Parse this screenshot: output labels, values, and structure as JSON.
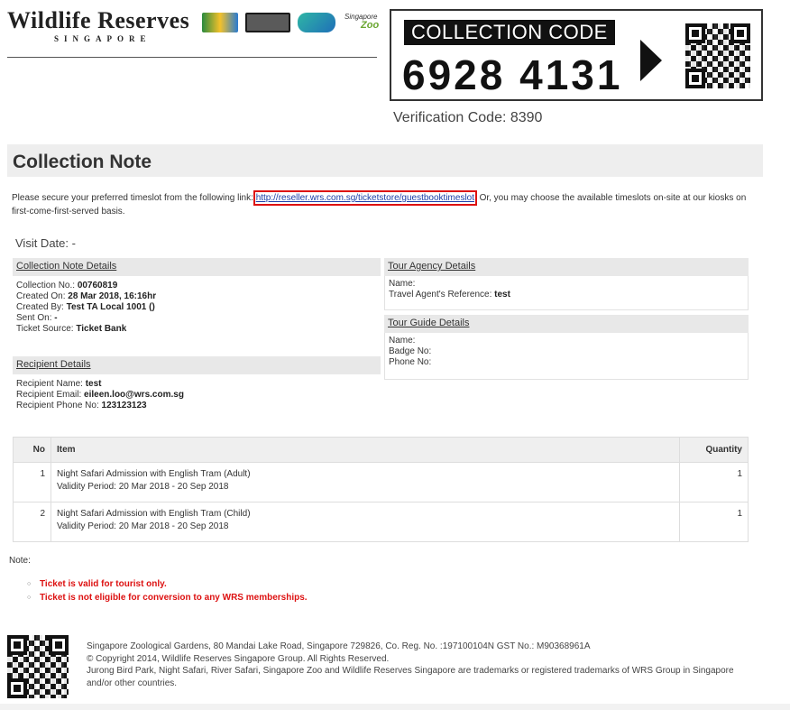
{
  "header": {
    "brand_name": "Wildlife Reserves",
    "brand_sub": "SINGAPORE",
    "park_logos": [
      "Jurong Bird Park",
      "Night Safari",
      "River Safari",
      "Singapore Zoo"
    ],
    "collection_code_label": "COLLECTION CODE",
    "collection_code": "6928 4131",
    "verification": "Verification Code: 8390"
  },
  "main": {
    "title": "Collection Note",
    "intro_before": "Please secure your preferred timeslot from the following link: ",
    "intro_link": "http://reseller.wrs.com.sg/ticketstore/guestbooktimeslot",
    "intro_after": ". Or, you may choose the available timeslots on-site at our kiosks on first-come-first-served basis.",
    "visit_date": "Visit Date: -"
  },
  "collection_details": {
    "heading": "Collection Note Details",
    "collection_no_label": "Collection No.: ",
    "collection_no": "00760819",
    "created_on_label": "Created On: ",
    "created_on": "28 Mar 2018, 16:16hr",
    "created_by_label": "Created By: ",
    "created_by": "Test TA Local 1001 ()",
    "sent_on_label": "Sent On: ",
    "sent_on": "-",
    "ticket_source_label": "Ticket Source: ",
    "ticket_source": "Ticket Bank"
  },
  "recipient": {
    "heading": "Recipient Details",
    "name_label": "Recipient Name: ",
    "name": "test",
    "email_label": "Recipient Email: ",
    "email": "eileen.loo@wrs.com.sg",
    "phone_label": "Recipient Phone No: ",
    "phone": "123123123"
  },
  "tour_agency": {
    "heading": "Tour Agency Details",
    "name_label": "Name:",
    "reference_label": "Travel Agent's Reference: ",
    "reference": "test"
  },
  "tour_guide": {
    "heading": "Tour Guide Details",
    "name_label": "Name:",
    "badge_label": "Badge No:",
    "phone_label": "Phone No:"
  },
  "items_table": {
    "headers": {
      "no": "No",
      "item": "Item",
      "quantity": "Quantity"
    },
    "rows": [
      {
        "no": "1",
        "item": "Night Safari Admission with English Tram (Adult)",
        "validity": "Validity Period: 20 Mar 2018 - 20 Sep 2018",
        "quantity": "1"
      },
      {
        "no": "2",
        "item": "Night Safari Admission with English Tram (Child)",
        "validity": "Validity Period: 20 Mar 2018 - 20 Sep 2018",
        "quantity": "1"
      }
    ]
  },
  "notes": {
    "label": "Note:",
    "items": [
      "Ticket is valid for tourist only.",
      "Ticket is not eligible for conversion to any WRS memberships."
    ]
  },
  "footer": {
    "line1": "Singapore Zoological Gardens, 80 Mandai Lake Road, Singapore 729826, Co. Reg. No. :197100104N GST No.: M90368961A",
    "line2": "© Copyright 2014, Wildlife Reserves Singapore Group. All Rights Reserved.",
    "line3": "Jurong Bird Park, Night Safari, River Safari, Singapore Zoo and Wildlife Reserves Singapore are trademarks or registered trademarks of WRS Group in Singapore and/or other countries."
  },
  "colors": {
    "accent_red": "#d11111",
    "link_blue": "#1a3ea8",
    "section_gray": "#e8e8e8"
  }
}
